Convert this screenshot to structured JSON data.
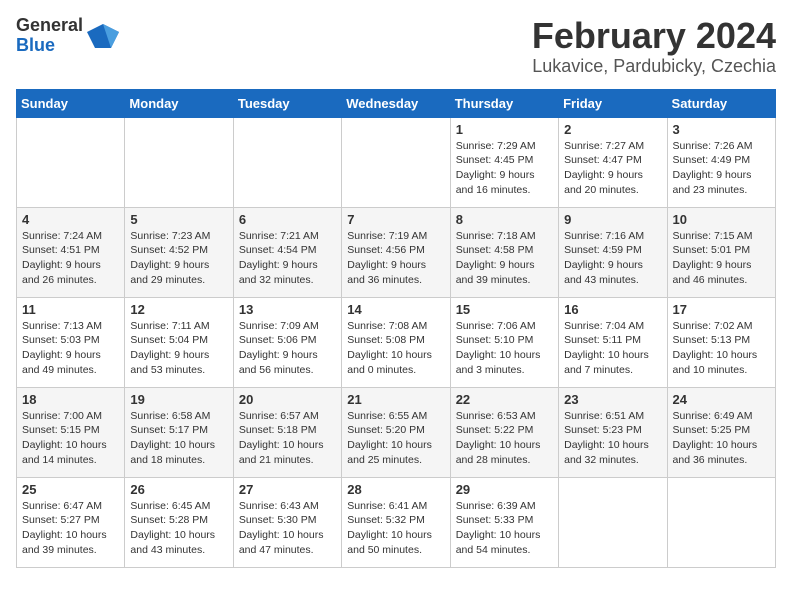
{
  "logo": {
    "general": "General",
    "blue": "Blue"
  },
  "title": "February 2024",
  "subtitle": "Lukavice, Pardubicky, Czechia",
  "days_header": [
    "Sunday",
    "Monday",
    "Tuesday",
    "Wednesday",
    "Thursday",
    "Friday",
    "Saturday"
  ],
  "weeks": [
    [
      {
        "day": "",
        "info": ""
      },
      {
        "day": "",
        "info": ""
      },
      {
        "day": "",
        "info": ""
      },
      {
        "day": "",
        "info": ""
      },
      {
        "day": "1",
        "info": "Sunrise: 7:29 AM\nSunset: 4:45 PM\nDaylight: 9 hours\nand 16 minutes."
      },
      {
        "day": "2",
        "info": "Sunrise: 7:27 AM\nSunset: 4:47 PM\nDaylight: 9 hours\nand 20 minutes."
      },
      {
        "day": "3",
        "info": "Sunrise: 7:26 AM\nSunset: 4:49 PM\nDaylight: 9 hours\nand 23 minutes."
      }
    ],
    [
      {
        "day": "4",
        "info": "Sunrise: 7:24 AM\nSunset: 4:51 PM\nDaylight: 9 hours\nand 26 minutes."
      },
      {
        "day": "5",
        "info": "Sunrise: 7:23 AM\nSunset: 4:52 PM\nDaylight: 9 hours\nand 29 minutes."
      },
      {
        "day": "6",
        "info": "Sunrise: 7:21 AM\nSunset: 4:54 PM\nDaylight: 9 hours\nand 32 minutes."
      },
      {
        "day": "7",
        "info": "Sunrise: 7:19 AM\nSunset: 4:56 PM\nDaylight: 9 hours\nand 36 minutes."
      },
      {
        "day": "8",
        "info": "Sunrise: 7:18 AM\nSunset: 4:58 PM\nDaylight: 9 hours\nand 39 minutes."
      },
      {
        "day": "9",
        "info": "Sunrise: 7:16 AM\nSunset: 4:59 PM\nDaylight: 9 hours\nand 43 minutes."
      },
      {
        "day": "10",
        "info": "Sunrise: 7:15 AM\nSunset: 5:01 PM\nDaylight: 9 hours\nand 46 minutes."
      }
    ],
    [
      {
        "day": "11",
        "info": "Sunrise: 7:13 AM\nSunset: 5:03 PM\nDaylight: 9 hours\nand 49 minutes."
      },
      {
        "day": "12",
        "info": "Sunrise: 7:11 AM\nSunset: 5:04 PM\nDaylight: 9 hours\nand 53 minutes."
      },
      {
        "day": "13",
        "info": "Sunrise: 7:09 AM\nSunset: 5:06 PM\nDaylight: 9 hours\nand 56 minutes."
      },
      {
        "day": "14",
        "info": "Sunrise: 7:08 AM\nSunset: 5:08 PM\nDaylight: 10 hours\nand 0 minutes."
      },
      {
        "day": "15",
        "info": "Sunrise: 7:06 AM\nSunset: 5:10 PM\nDaylight: 10 hours\nand 3 minutes."
      },
      {
        "day": "16",
        "info": "Sunrise: 7:04 AM\nSunset: 5:11 PM\nDaylight: 10 hours\nand 7 minutes."
      },
      {
        "day": "17",
        "info": "Sunrise: 7:02 AM\nSunset: 5:13 PM\nDaylight: 10 hours\nand 10 minutes."
      }
    ],
    [
      {
        "day": "18",
        "info": "Sunrise: 7:00 AM\nSunset: 5:15 PM\nDaylight: 10 hours\nand 14 minutes."
      },
      {
        "day": "19",
        "info": "Sunrise: 6:58 AM\nSunset: 5:17 PM\nDaylight: 10 hours\nand 18 minutes."
      },
      {
        "day": "20",
        "info": "Sunrise: 6:57 AM\nSunset: 5:18 PM\nDaylight: 10 hours\nand 21 minutes."
      },
      {
        "day": "21",
        "info": "Sunrise: 6:55 AM\nSunset: 5:20 PM\nDaylight: 10 hours\nand 25 minutes."
      },
      {
        "day": "22",
        "info": "Sunrise: 6:53 AM\nSunset: 5:22 PM\nDaylight: 10 hours\nand 28 minutes."
      },
      {
        "day": "23",
        "info": "Sunrise: 6:51 AM\nSunset: 5:23 PM\nDaylight: 10 hours\nand 32 minutes."
      },
      {
        "day": "24",
        "info": "Sunrise: 6:49 AM\nSunset: 5:25 PM\nDaylight: 10 hours\nand 36 minutes."
      }
    ],
    [
      {
        "day": "25",
        "info": "Sunrise: 6:47 AM\nSunset: 5:27 PM\nDaylight: 10 hours\nand 39 minutes."
      },
      {
        "day": "26",
        "info": "Sunrise: 6:45 AM\nSunset: 5:28 PM\nDaylight: 10 hours\nand 43 minutes."
      },
      {
        "day": "27",
        "info": "Sunrise: 6:43 AM\nSunset: 5:30 PM\nDaylight: 10 hours\nand 47 minutes."
      },
      {
        "day": "28",
        "info": "Sunrise: 6:41 AM\nSunset: 5:32 PM\nDaylight: 10 hours\nand 50 minutes."
      },
      {
        "day": "29",
        "info": "Sunrise: 6:39 AM\nSunset: 5:33 PM\nDaylight: 10 hours\nand 54 minutes."
      },
      {
        "day": "",
        "info": ""
      },
      {
        "day": "",
        "info": ""
      }
    ]
  ]
}
